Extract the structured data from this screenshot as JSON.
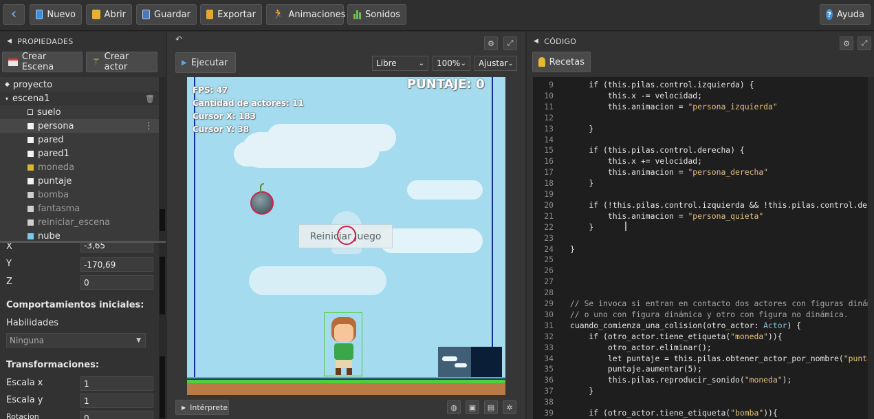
{
  "toolbar": {
    "back": "‹",
    "nuevo": "Nuevo",
    "abrir": "Abrir",
    "guardar": "Guardar",
    "exportar": "Exportar",
    "animaciones": "Animaciones",
    "sonidos": "Sonidos",
    "ayuda": "Ayuda"
  },
  "properties": {
    "header": "PROPIEDADES",
    "crear_escena": "Crear Escena",
    "crear_actor": "Crear actor",
    "tree": {
      "proyecto": "proyecto",
      "escena": "escena1",
      "items": [
        "suelo",
        "persona",
        "pared",
        "pared1",
        "moneda",
        "puntaje",
        "bomba",
        "fantasma",
        "reiniciar_escena",
        "nube"
      ]
    },
    "fields": {
      "x_label": "X",
      "x_value": "-3,65",
      "y_label": "Y",
      "y_value": "-170,69",
      "z_label": "Z",
      "z_value": "0"
    },
    "comportamientos": "Comportamientos iniciales:",
    "habilidades": "Habilidades",
    "habilidades_value": "Ninguna",
    "transformaciones": "Transformaciones:",
    "escala_x_label": "Escala x",
    "escala_x_value": "1",
    "escala_y_label": "Escala y",
    "escala_y_value": "1",
    "rotacion_label": "Rotacion",
    "rotacion_value": "0"
  },
  "stage": {
    "undo": "↶",
    "ejecutar": "Ejecutar",
    "mode": "Libre",
    "zoom": "100%",
    "fit": "Ajustar",
    "puntaje": "PUNTAJE: 0",
    "fps": "FPS: 47",
    "actores": "Cantidad de actores: 11",
    "cursor_x": "Cursor X: 183",
    "cursor_y": "Cursor Y: 38",
    "reiniciar": "Reiniciar Juego",
    "interprete": "Intérprete"
  },
  "code": {
    "header": "CÓDIGO",
    "recetas": "Recetas",
    "lines": [
      {
        "n": "9",
        "t": "    if (this.pilas.control.izquierda) {"
      },
      {
        "n": "10",
        "t": "        this.x -= velocidad;"
      },
      {
        "n": "11",
        "t": "        this.animacion = \"persona_izquierda\""
      },
      {
        "n": "12",
        "t": ""
      },
      {
        "n": "13",
        "t": "    }"
      },
      {
        "n": "14",
        "t": ""
      },
      {
        "n": "15",
        "t": "    if (this.pilas.control.derecha) {"
      },
      {
        "n": "16",
        "t": "        this.x += velocidad;"
      },
      {
        "n": "17",
        "t": "        this.animacion = \"persona_derecha\""
      },
      {
        "n": "18",
        "t": "    }"
      },
      {
        "n": "19",
        "t": ""
      },
      {
        "n": "20",
        "t": "    if (!this.pilas.control.izquierda && !this.pilas.control.derecha"
      },
      {
        "n": "21",
        "t": "        this.animacion = \"persona_quieta\""
      },
      {
        "n": "22",
        "t": "    }"
      },
      {
        "n": "23",
        "t": ""
      },
      {
        "n": "24",
        "t": "}"
      },
      {
        "n": "25",
        "t": ""
      },
      {
        "n": "26",
        "t": ""
      },
      {
        "n": "27",
        "t": ""
      },
      {
        "n": "28",
        "t": ""
      },
      {
        "n": "29",
        "t": "// Se invoca si entran en contacto dos actores con figuras dinámi"
      },
      {
        "n": "30",
        "t": "// o uno con figura dinámica y otro con figura no dinámica."
      },
      {
        "n": "31",
        "t": "cuando_comienza_una_colision(otro_actor: Actor) {"
      },
      {
        "n": "32",
        "t": "    if (otro_actor.tiene_etiqueta(\"moneda\")){"
      },
      {
        "n": "33",
        "t": "        otro_actor.eliminar();"
      },
      {
        "n": "34",
        "t": "        let puntaje = this.pilas.obtener_actor_por_nombre(\"puntaj"
      },
      {
        "n": "35",
        "t": "        puntaje.aumentar(5);"
      },
      {
        "n": "36",
        "t": "        this.pilas.reproducir_sonido(\"moneda\");"
      },
      {
        "n": "37",
        "t": "    }"
      },
      {
        "n": "38",
        "t": ""
      },
      {
        "n": "39",
        "t": "    if (otro_actor.tiene_etiqueta(\"bomba\")){"
      }
    ]
  },
  "colors": {
    "sky": "#a4dbef",
    "ground_green": "#4fcf3a",
    "ground_dirt": "#b97a45",
    "accent_red": "#d02050",
    "bounds_blue": "#1a2aa0"
  }
}
